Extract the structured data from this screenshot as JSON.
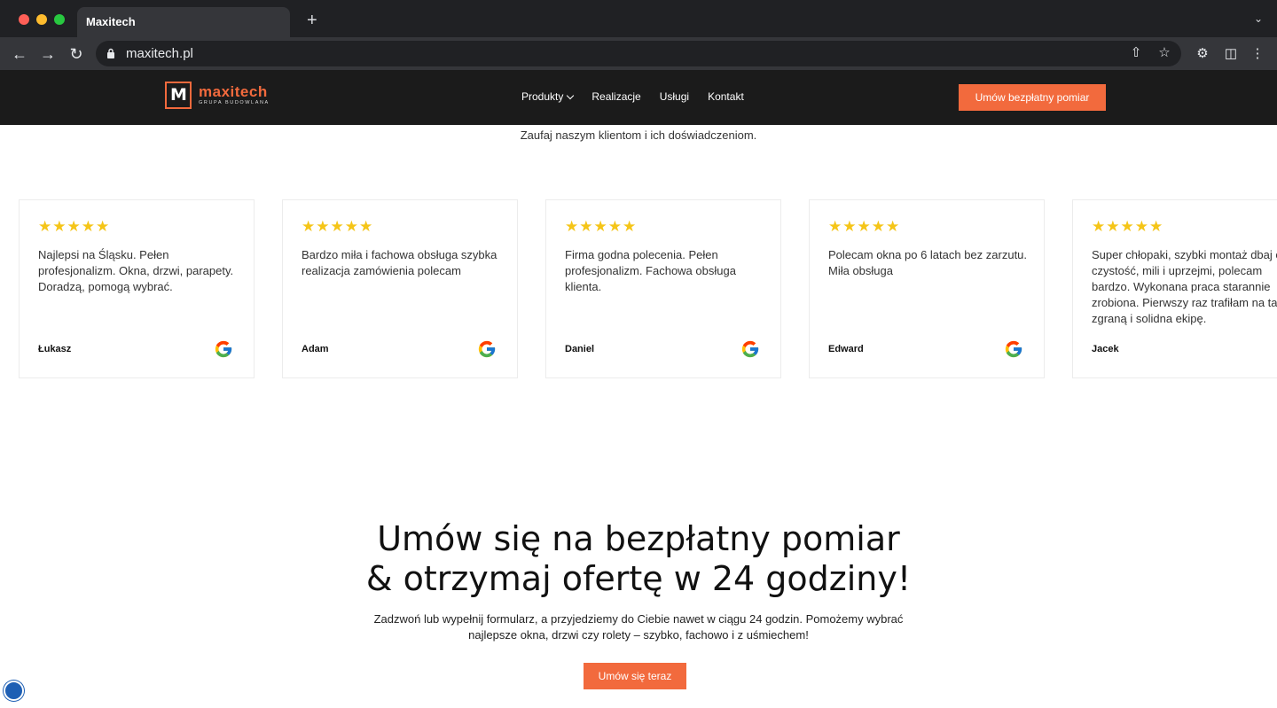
{
  "browser": {
    "tab_title": "Maxitech",
    "new_tab": "+",
    "url": "maxitech.pl"
  },
  "site": {
    "logo_word": "maxitech",
    "logo_sub": "GRUPA BUDOWLANA",
    "menu": [
      "Produkty",
      "Realizacje",
      "Usługi",
      "Kontakt"
    ],
    "cta_top": "Umów bezpłatny pomiar"
  },
  "intro": "Zaufaj naszym klientom i ich doświadczeniom.",
  "reviews": [
    {
      "stars": "★★★★★",
      "text": "Najlepsi na Śląsku. Pełen profesjonalizm. Okna, drzwi, parapety. Doradzą, pomogą wybrać.",
      "name": "Łukasz"
    },
    {
      "stars": "★★★★★",
      "text": "Bardzo miła i fachowa obsługa szybka realizacja zamówienia polecam",
      "name": "Adam"
    },
    {
      "stars": "★★★★★",
      "text": "Firma godna polecenia. Pełen profesjonalizm. Fachowa obsługa klienta.",
      "name": "Daniel"
    },
    {
      "stars": "★★★★★",
      "text": "Polecam okna po 6 latach bez zarzutu. Miła obsługa",
      "name": "Edward"
    },
    {
      "stars": "★★★★★",
      "text": "Super chłopaki, szybki montaż dbaj o czystość, mili i uprzejmi, polecam bardzo. Wykonana praca starannie zrobiona. Pierwszy raz trafiłam na ta zgraną i solidna ekipę.",
      "name": "Jacek"
    }
  ],
  "headline_1": "Umów się na bezpłatny pomiar",
  "headline_2": "& otrzymaj ofertę w 24 godziny!",
  "subtext": "Zadzwoń lub wypełnij formularz, a przyjedziemy do Ciebie nawet w ciągu 24 godzin. Pomożemy wybrać najlepsze okna, drzwi czy rolety – szybko, fachowo i z uśmiechem!",
  "cta_bottom": "Umów się teraz",
  "colors": {
    "accent": "#f26a3d",
    "stars": "#f5c518",
    "header_bg": "#1b1b1b"
  }
}
